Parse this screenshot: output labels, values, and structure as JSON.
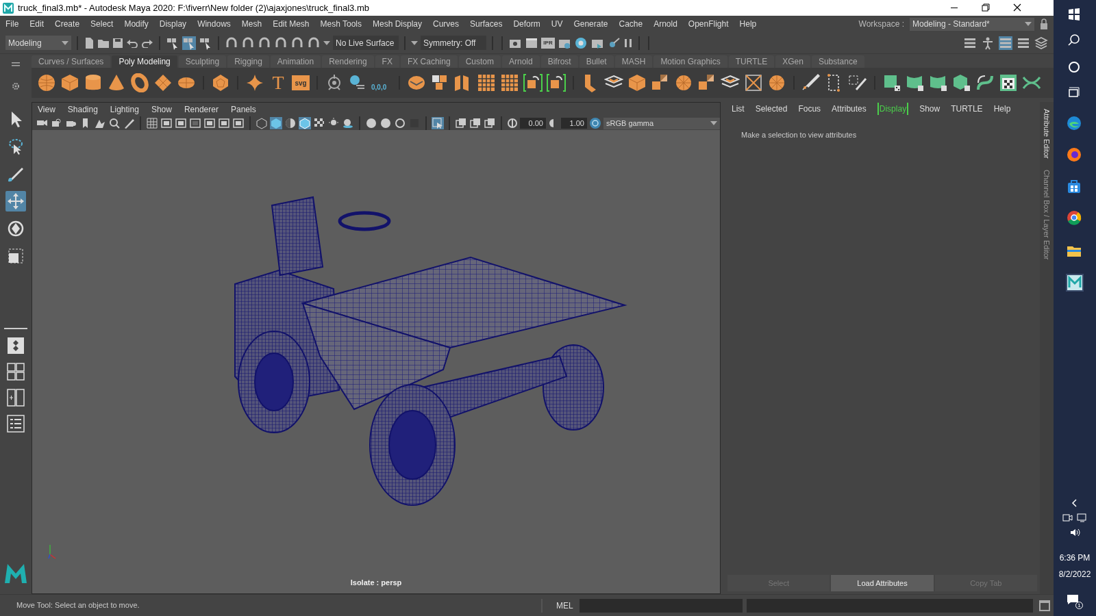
{
  "window": {
    "title": "truck_final3.mb* - Autodesk Maya 2020: F:\\fiverr\\New folder (2)\\ajaxjones\\truck_final3.mb"
  },
  "menu_bar": [
    "File",
    "Edit",
    "Create",
    "Select",
    "Modify",
    "Display",
    "Windows",
    "Mesh",
    "Edit Mesh",
    "Mesh Tools",
    "Mesh Display",
    "Curves",
    "Surfaces",
    "Deform",
    "UV",
    "Generate",
    "Cache",
    "Arnold",
    "OpenFlight",
    "Help"
  ],
  "workspace": {
    "label": "Workspace :",
    "value": "Modeling - Standard*"
  },
  "status_line": {
    "menu_set": "Modeling",
    "live_surface": "No Live Surface",
    "symmetry": "Symmetry: Off",
    "ipr_label": "IPR"
  },
  "shelf": {
    "tabs": [
      {
        "label": "Curves / Surfaces",
        "selected": false
      },
      {
        "label": "Poly Modeling",
        "selected": true
      },
      {
        "label": "Sculpting",
        "selected": false
      },
      {
        "label": "Rigging",
        "selected": false
      },
      {
        "label": "Animation",
        "selected": false
      },
      {
        "label": "Rendering",
        "selected": false
      },
      {
        "label": "FX",
        "selected": false
      },
      {
        "label": "FX Caching",
        "selected": false
      },
      {
        "label": "Custom",
        "selected": false
      },
      {
        "label": "Arnold",
        "selected": false
      },
      {
        "label": "Bifrost",
        "selected": false
      },
      {
        "label": "Bullet",
        "selected": false
      },
      {
        "label": "MASH",
        "selected": false
      },
      {
        "label": "Motion Graphics",
        "selected": false
      },
      {
        "label": "TURTLE",
        "selected": false
      },
      {
        "label": "XGen",
        "selected": false
      },
      {
        "label": "Substance",
        "selected": false
      }
    ],
    "type_tool_glyph": "T",
    "svg_tool_label": "svg",
    "seed_label": "0,0,0"
  },
  "tools": [
    {
      "kind": "select",
      "selected": false
    },
    {
      "kind": "lasso",
      "selected": false
    },
    {
      "kind": "paint",
      "selected": false
    },
    {
      "kind": "move",
      "selected": true
    },
    {
      "kind": "rotate",
      "selected": false
    },
    {
      "kind": "scale",
      "selected": false
    }
  ],
  "viewport": {
    "menus": [
      "View",
      "Shading",
      "Lighting",
      "Show",
      "Renderer",
      "Panels"
    ],
    "exposure": "0.00",
    "gamma": "1.00",
    "color_space": "sRGB gamma",
    "camera_label": "Isolate : persp"
  },
  "attribute_editor": {
    "menus": [
      {
        "label": "List",
        "selected": false
      },
      {
        "label": "Selected",
        "selected": false
      },
      {
        "label": "Focus",
        "selected": false
      },
      {
        "label": "Attributes",
        "selected": false
      },
      {
        "label": "Display",
        "selected": true
      },
      {
        "label": "Show",
        "selected": false
      },
      {
        "label": "TURTLE",
        "selected": false
      },
      {
        "label": "Help",
        "selected": false
      }
    ],
    "message": "Make a selection to view attributes",
    "buttons": [
      {
        "label": "Select",
        "disabled": true
      },
      {
        "label": "Load Attributes",
        "disabled": false
      },
      {
        "label": "Copy Tab",
        "disabled": true
      }
    ]
  },
  "side_tabs": [
    "Attribute Editor",
    "Channel Box / Layer Editor"
  ],
  "help_line": "Move Tool: Select an object to move.",
  "command_line": {
    "label": "MEL"
  },
  "taskbar": {
    "time": "6:36 PM",
    "date": "8/2/2022",
    "notification_count": "1"
  }
}
